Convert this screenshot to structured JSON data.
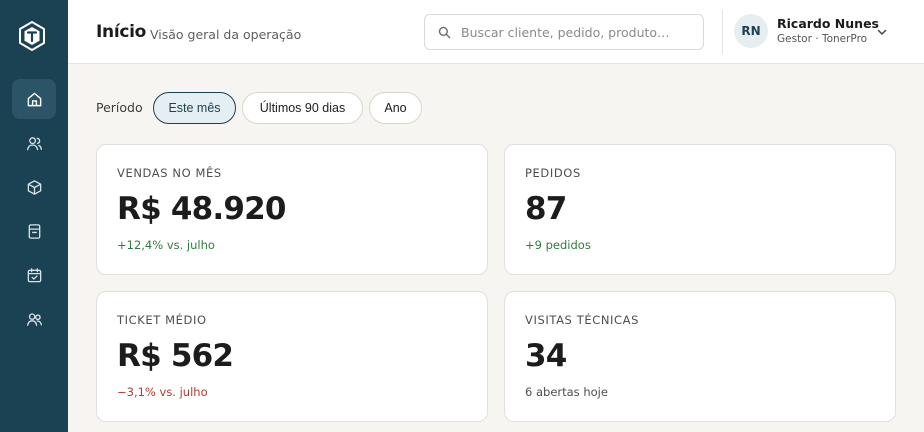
{
  "header": {
    "title": "Início",
    "subtitle": "Visão geral da operação",
    "search_placeholder": "Buscar cliente, pedido, produto…"
  },
  "user": {
    "initials": "RN",
    "name": "Ricardo Nunes",
    "role": "Gestor · TonerPro"
  },
  "sidebar": {
    "items": [
      {
        "icon": "home-icon",
        "active": true
      },
      {
        "icon": "users-icon",
        "active": false
      },
      {
        "icon": "box-icon",
        "active": false
      },
      {
        "icon": "document-icon",
        "active": false
      },
      {
        "icon": "calendar-icon",
        "active": false
      },
      {
        "icon": "team-icon",
        "active": false
      }
    ]
  },
  "period": {
    "label": "Período",
    "options": [
      "Este mês",
      "Últimos 90 dias",
      "Ano"
    ],
    "selected": "Este mês"
  },
  "cards": [
    {
      "label": "VENDAS NO MÊS",
      "value": "R$ 48.920",
      "delta": "+12,4% vs. julho",
      "trend": "positive"
    },
    {
      "label": "PEDIDOS",
      "value": "87",
      "delta": "+9 pedidos",
      "trend": "positive"
    },
    {
      "label": "TICKET MÉDIO",
      "value": "R$ 562",
      "delta": "−3,1% vs. julho",
      "trend": "negative"
    },
    {
      "label": "VISITAS TÉCNICAS",
      "value": "34",
      "delta": "6 abertas hoje",
      "trend": "neutral"
    }
  ],
  "colors": {
    "sidebar_bg": "#1b4252",
    "sidebar_active": "#2b5566",
    "accent": "#1b4252",
    "positive": "#2e7d3e",
    "negative": "#b63a2a",
    "page_bg": "#f6f5f2"
  }
}
